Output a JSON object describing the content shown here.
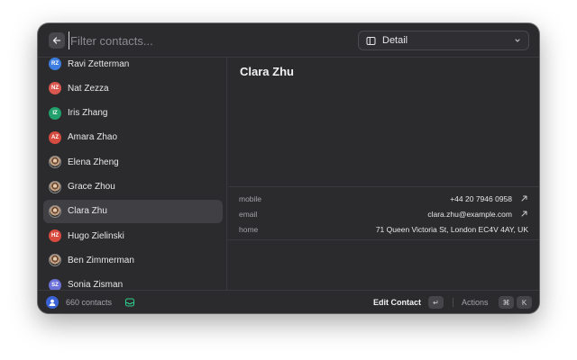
{
  "search": {
    "placeholder": "Filter contacts..."
  },
  "view_select": {
    "label": "Detail"
  },
  "contacts": [
    {
      "name": "Ravi Zetterman",
      "initials": "RZ",
      "color": "#3d7de0",
      "photo": false
    },
    {
      "name": "Nat Zezza",
      "initials": "NZ",
      "color": "#d9574e",
      "photo": false
    },
    {
      "name": "Iris Zhang",
      "initials": "IZ",
      "color": "#22a06b",
      "photo": false
    },
    {
      "name": "Amara Zhao",
      "initials": "AZ",
      "color": "#d64b3f",
      "photo": false
    },
    {
      "name": "Elena Zheng",
      "initials": "",
      "color": "#8a8a8a",
      "photo": true
    },
    {
      "name": "Grace Zhou",
      "initials": "",
      "color": "#8a8a8a",
      "photo": true
    },
    {
      "name": "Clara Zhu",
      "initials": "",
      "color": "#8a8a8a",
      "photo": true,
      "selected": true
    },
    {
      "name": "Hugo Zielinski",
      "initials": "HZ",
      "color": "#d84a3e",
      "photo": false
    },
    {
      "name": "Ben Zimmerman",
      "initials": "",
      "color": "#8a8a8a",
      "photo": true
    },
    {
      "name": "Sonia Zisman",
      "initials": "SZ",
      "color": "#6b6fd8",
      "photo": false
    }
  ],
  "detail": {
    "name": "Clara Zhu",
    "fields": [
      {
        "label": "mobile",
        "value": "+44 20 7946 0958",
        "action": "arrow-up-right-icon"
      },
      {
        "label": "email",
        "value": "clara.zhu@example.com",
        "action": "arrow-up-right-icon"
      },
      {
        "label": "home",
        "value": "71 Queen Victoria St, London EC4V 4AY, UK",
        "action": ""
      }
    ]
  },
  "footer": {
    "count": "660 contacts",
    "edit_label": "Edit Contact",
    "edit_key": "↵",
    "actions_label": "Actions",
    "actions_key_1": "⌘",
    "actions_key_2": "K"
  },
  "colors": {
    "accent_green": "#2ecc8a",
    "footer_avatar": "#3b63d6"
  }
}
